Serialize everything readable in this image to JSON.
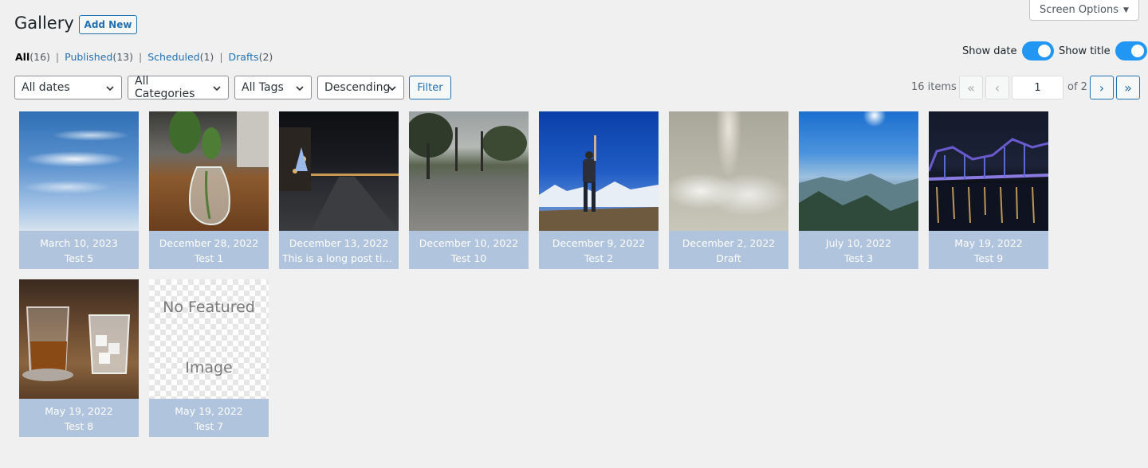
{
  "header": {
    "title": "Gallery",
    "add_new_label": "Add New",
    "screen_options_label": "Screen Options"
  },
  "views": [
    {
      "label": "All",
      "count": "(16)",
      "current": true
    },
    {
      "label": "Published",
      "count": "(13)"
    },
    {
      "label": "Scheduled",
      "count": "(1)"
    },
    {
      "label": "Drafts",
      "count": "(2)"
    }
  ],
  "toggles": {
    "show_date": {
      "label": "Show date",
      "on": true
    },
    "show_title": {
      "label": "Show title",
      "on": true
    }
  },
  "filters": {
    "dates": "All dates",
    "categories": "All Categories",
    "tags": "All Tags",
    "order": "Descending",
    "filter_label": "Filter"
  },
  "pagination": {
    "items_label": "16 items",
    "first": "«",
    "prev": "‹",
    "current_page": "1",
    "of_label": "of 2",
    "next": "›",
    "last": "»"
  },
  "colors": {
    "accent": "#2271b1",
    "card_meta_bg": "#b0c4de",
    "toggle_on": "#2196f3"
  },
  "cards": [
    {
      "date": "March 10, 2023",
      "title": "Test 5",
      "image": "blue-sky-clouds"
    },
    {
      "date": "December 28, 2022",
      "title": "Test 1",
      "image": "plant-in-glass-vase"
    },
    {
      "date": "December 13, 2022",
      "title": "This is a long post titl…",
      "image": "night-street-waterfront"
    },
    {
      "date": "December 10, 2022",
      "title": "Test 10",
      "image": "park-with-trees"
    },
    {
      "date": "December 9, 2022",
      "title": "Test 2",
      "image": "hiker-mountains"
    },
    {
      "date": "December 2, 2022",
      "title": "Draft",
      "image": "cloudy-sky"
    },
    {
      "date": "July 10, 2022",
      "title": "Test 3",
      "image": "hazy-mountain-valley"
    },
    {
      "date": "May 19, 2022",
      "title": "Test 9",
      "image": "lit-bridge-at-night"
    },
    {
      "date": "May 19, 2022",
      "title": "Test 8",
      "image": "whiskey-glasses"
    },
    {
      "date": "May 19, 2022",
      "title": "Test 7",
      "image": "no-featured-image",
      "placeholder_line1": "No Featured",
      "placeholder_line2": "Image"
    }
  ]
}
